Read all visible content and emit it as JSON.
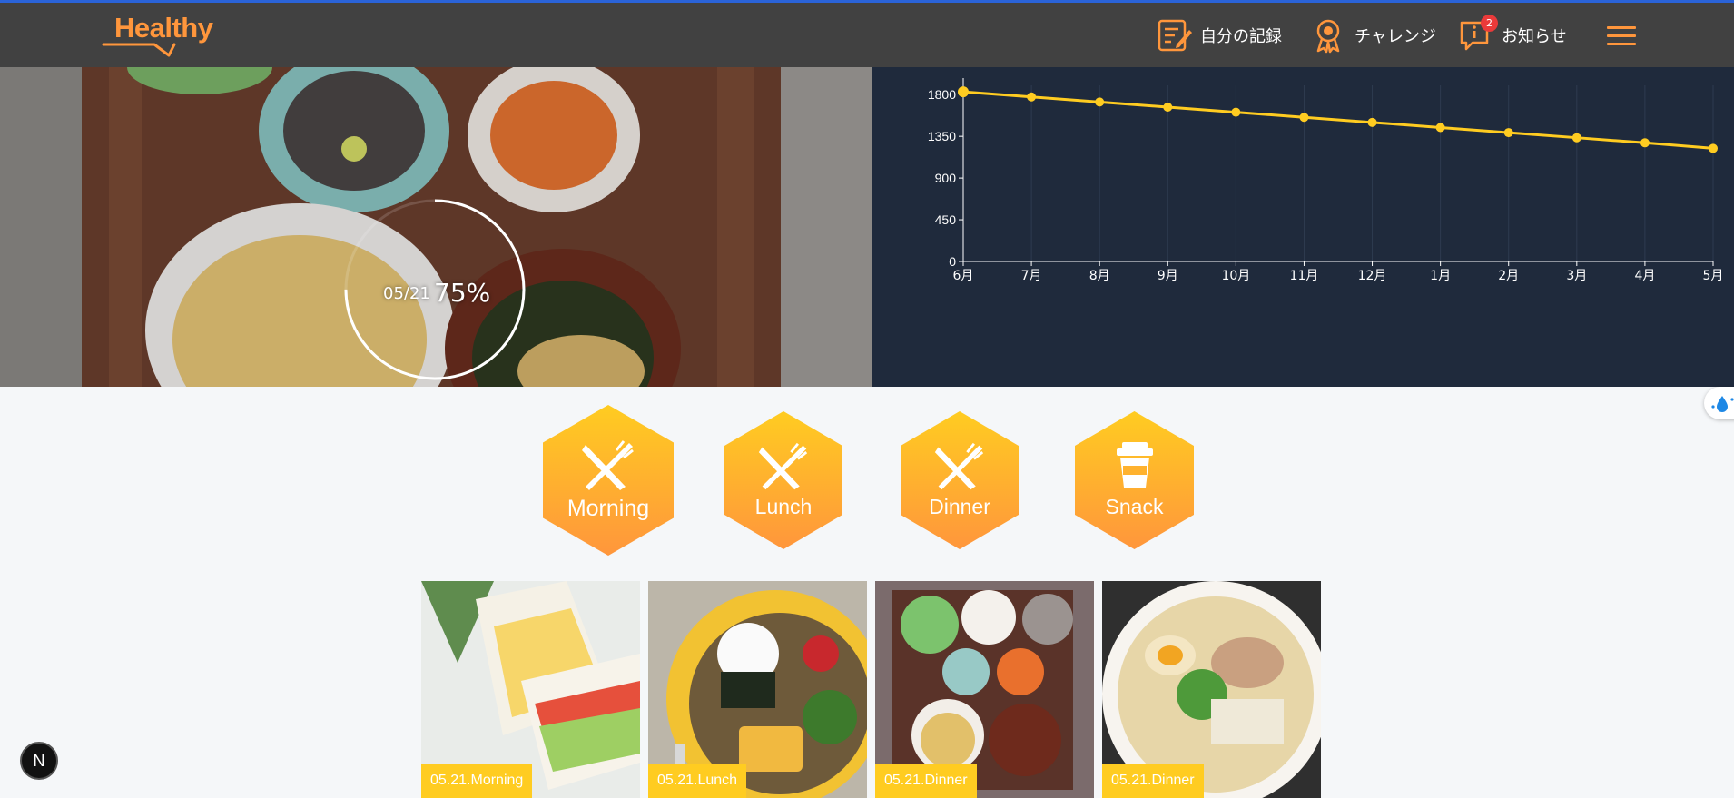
{
  "app": {
    "logo_text": "Healthy"
  },
  "header": {
    "nav": [
      {
        "label": "自分の記録",
        "icon": "memo-icon"
      },
      {
        "label": "チャレンジ",
        "icon": "award-icon"
      },
      {
        "label": "お知らせ",
        "icon": "info-icon",
        "badge": "2"
      }
    ],
    "menu_icon": "hamburger-menu-icon"
  },
  "hero": {
    "date": "05/21",
    "percent": "75%",
    "progress": 0.75
  },
  "chart_data": {
    "type": "line",
    "categories": [
      "6月",
      "7月",
      "8月",
      "9月",
      "10月",
      "11月",
      "12月",
      "1月",
      "2月",
      "3月",
      "4月",
      "5月"
    ],
    "series": [
      {
        "values": [
          1830,
          1775,
          1720,
          1665,
          1610,
          1555,
          1500,
          1445,
          1390,
          1335,
          1280,
          1220
        ]
      }
    ],
    "yticks": [
      "0",
      "450",
      "900",
      "1350",
      "1800"
    ],
    "ylim": [
      0,
      1900
    ],
    "colors": {
      "line": "#ffcc21",
      "grid": "#2e3b50",
      "axis": "#ffffff"
    }
  },
  "meal_buttons": [
    {
      "label": "Morning",
      "icon": "knife-fork-icon"
    },
    {
      "label": "Lunch",
      "icon": "knife-fork-icon"
    },
    {
      "label": "Dinner",
      "icon": "knife-fork-icon"
    },
    {
      "label": "Snack",
      "icon": "cup-icon"
    }
  ],
  "photos": [
    {
      "label": "05.21.Morning"
    },
    {
      "label": "05.21.Lunch"
    },
    {
      "label": "05.21.Dinner"
    },
    {
      "label": "05.21.Dinner"
    }
  ],
  "dev_badge": "N",
  "colors": {
    "primary": "#ff963c",
    "secondary": "#ffcc21",
    "dark": "#414141"
  }
}
